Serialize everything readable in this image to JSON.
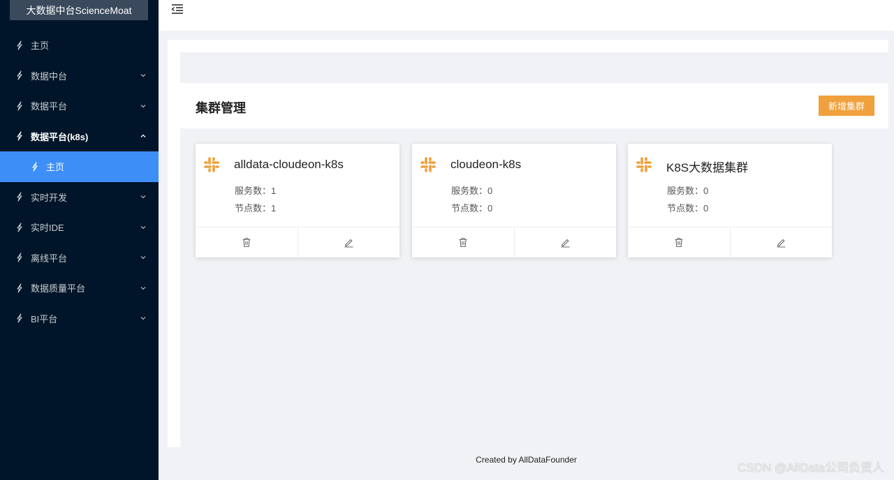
{
  "app": {
    "title": "大数据中台ScienceMoat"
  },
  "sidebar": {
    "items": [
      {
        "label": "主页"
      },
      {
        "label": "数据中台"
      },
      {
        "label": "数据平台"
      },
      {
        "label": "数据平台(k8s)"
      },
      {
        "label": "主页"
      },
      {
        "label": "实时开发"
      },
      {
        "label": "实时IDE"
      },
      {
        "label": "离线平台"
      },
      {
        "label": "数据质量平台"
      },
      {
        "label": "BI平台"
      }
    ]
  },
  "main": {
    "title": "集群管理",
    "add_button": "新增集群",
    "cards": [
      {
        "name": "alldata-cloudeon-k8s",
        "services": "服务数：1",
        "nodes": "节点数：1"
      },
      {
        "name": "cloudeon-k8s",
        "services": "服务数：0",
        "nodes": "节点数：0"
      },
      {
        "name": "K8S大数据集群",
        "services": "服务数：0",
        "nodes": "节点数：0"
      }
    ]
  },
  "footer": {
    "text": "Created by AllDataFounder"
  },
  "watermark": {
    "text": "CSDN @AllData公司负责人"
  },
  "colors": {
    "sidebar": "#001529",
    "active": "#3d8ff7",
    "accent": "#f0a03c"
  },
  "icons": {
    "menu": "lightning-icon",
    "cluster": "slack-icon",
    "delete": "trash-icon",
    "edit": "edit-icon",
    "fold": "menu-fold-icon"
  }
}
